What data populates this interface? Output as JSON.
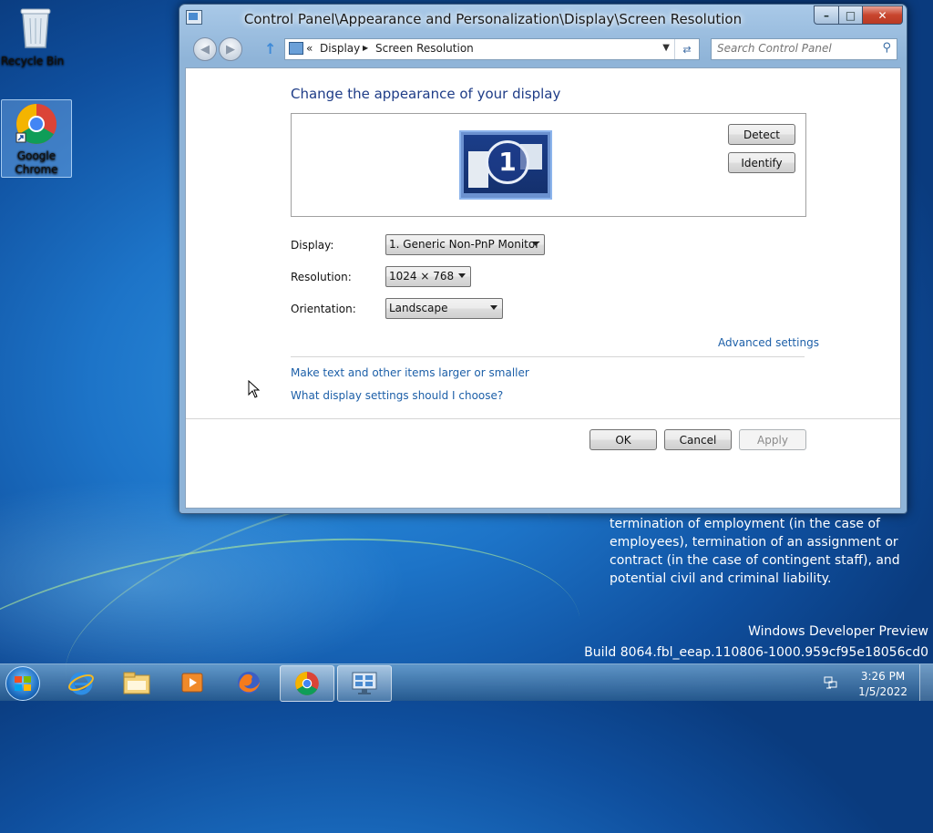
{
  "desktop": {
    "icons": [
      {
        "label": "Recycle Bin"
      },
      {
        "label": "Google Chrome"
      }
    ],
    "notice_text": "termination of employment (in the case of employees), termination of an assignment or contract (in the case of contingent staff), and potential civil and criminal liability.",
    "watermark_line1": "Windows Developer Preview",
    "watermark_line2": "Build 8064.fbl_eeap.110806-1000.959cf95e18056cd0"
  },
  "window": {
    "title": "Control Panel\\Appearance and Personalization\\Display\\Screen Resolution",
    "address": {
      "prefix": "«",
      "crumbs": [
        "Display",
        "Screen Resolution"
      ]
    },
    "search_placeholder": "Search Control Panel",
    "heading": "Change the appearance of your display",
    "monitor_number": "1",
    "buttons": {
      "detect": "Detect",
      "identify": "Identify",
      "ok": "OK",
      "cancel": "Cancel",
      "apply": "Apply"
    },
    "fields": {
      "display_label": "Display:",
      "display_value": "1. Generic Non-PnP Monitor",
      "resolution_label": "Resolution:",
      "resolution_value": "1024 × 768",
      "orientation_label": "Orientation:",
      "orientation_value": "Landscape"
    },
    "links": {
      "advanced": "Advanced settings",
      "text_size": "Make text and other items larger or smaller",
      "help": "What display settings should I choose?"
    }
  },
  "taskbar": {
    "time": "3:26 PM",
    "date": "1/5/2022",
    "pinned": [
      "ie-icon",
      "explorer-icon",
      "media-player-icon",
      "firefox-icon",
      "chrome-icon",
      "display-settings-icon"
    ]
  }
}
